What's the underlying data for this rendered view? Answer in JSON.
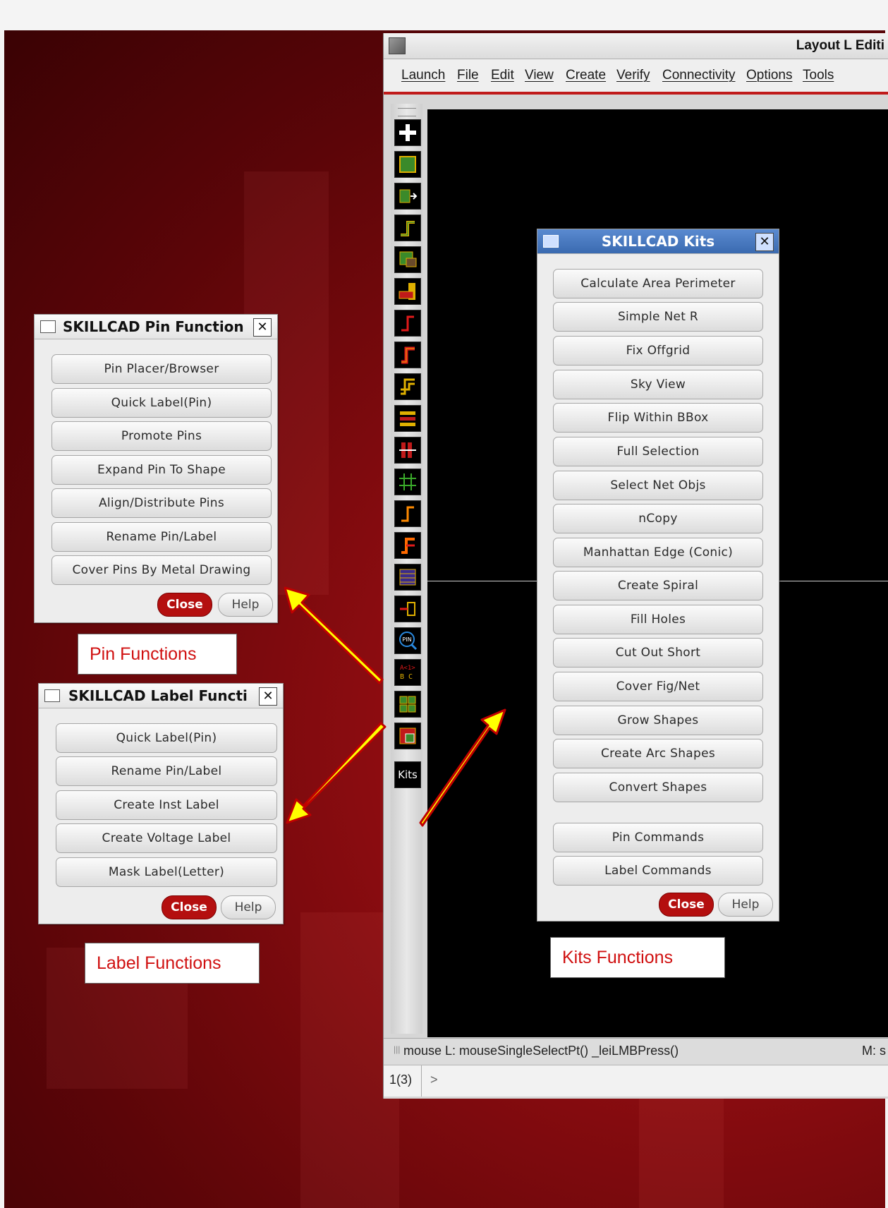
{
  "window": {
    "title": "Layout L Editi"
  },
  "menu": [
    "Launch",
    "File",
    "Edit",
    "View",
    "Create",
    "Verify",
    "Connectivity",
    "Options",
    "Tools"
  ],
  "toolbar": {
    "kits_label": "Kits",
    "pin_label": "PIN",
    "label_tool_text": "A<1>\nB C"
  },
  "status": {
    "mouse": "mouse L: mouseSingleSelectPt() _leiLMBPress()",
    "right": "M: s"
  },
  "command": {
    "counter": "1(3)",
    "prompt": ">"
  },
  "pin_dialog": {
    "title": "SKILLCAD Pin Function",
    "buttons": [
      "Pin Placer/Browser",
      "Quick Label(Pin)",
      "Promote Pins",
      "Expand Pin To Shape",
      "Align/Distribute Pins",
      "Rename Pin/Label",
      "Cover Pins By Metal Drawing"
    ],
    "close": "Close",
    "help": "Help"
  },
  "label_dialog": {
    "title": "SKILLCAD Label Functi",
    "buttons": [
      "Quick Label(Pin)",
      "Rename Pin/Label",
      "Create Inst Label",
      "Create Voltage Label",
      "Mask Label(Letter)"
    ],
    "close": "Close",
    "help": "Help"
  },
  "kits_dialog": {
    "title": "SKILLCAD Kits",
    "buttons": [
      "Calculate Area Perimeter",
      "Simple Net R",
      "Fix Offgrid",
      "Sky View",
      "Flip Within BBox",
      "Full Selection",
      "Select Net Objs",
      "nCopy",
      "Manhattan Edge (Conic)",
      "Create Spiral",
      "Fill Holes",
      "Cut Out Short",
      "Cover Fig/Net",
      "Grow Shapes",
      "Create Arc Shapes",
      "Convert Shapes"
    ],
    "extra_buttons": [
      "Pin Commands",
      "Label Commands"
    ],
    "close": "Close",
    "help": "Help"
  },
  "captions": {
    "pin": "Pin Functions",
    "label": "Label Functions",
    "kits": "Kits Functions"
  },
  "colors": {
    "accent": "#c01a1a",
    "close_button": "#b40f0f",
    "caption_text": "#d01010",
    "arrow_fill": "#ffff00",
    "arrow_stroke": "#c00000"
  }
}
